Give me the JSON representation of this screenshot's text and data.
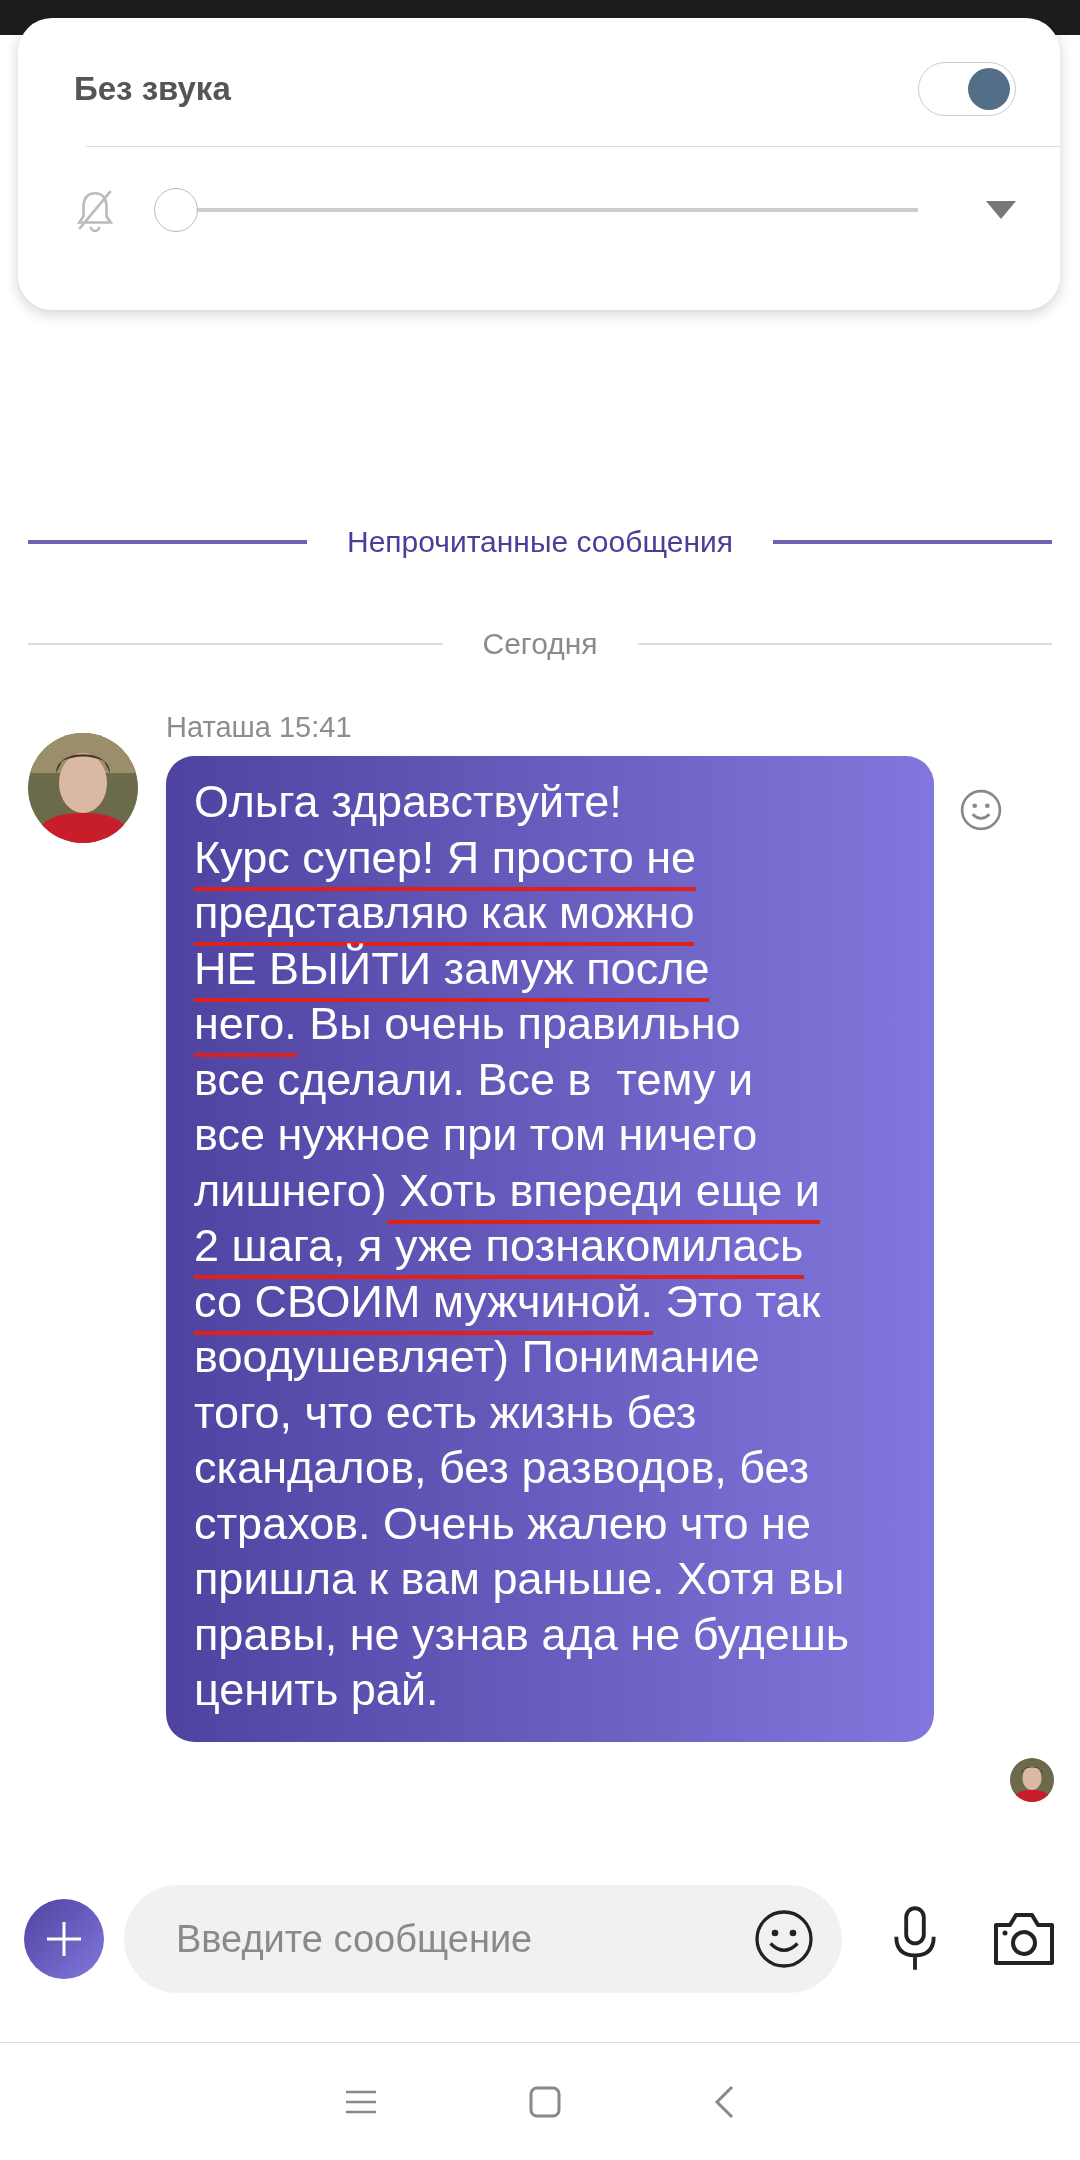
{
  "sound_panel": {
    "title": "Без звука",
    "toggle": {
      "on": true
    },
    "volume": {
      "level": 0
    }
  },
  "dividers": [
    {
      "kind": "unread",
      "label": "Непрочитанные сообщения"
    },
    {
      "kind": "date",
      "label": "Сегодня"
    }
  ],
  "message": {
    "sender": "Наташа 15:41",
    "lines": [
      [
        {
          "text": "Ольга здравствуйте!",
          "underlined": false
        }
      ],
      [
        {
          "text": "Курс супер! Я просто не",
          "underlined": true
        }
      ],
      [
        {
          "text": "представляю как можно",
          "underlined": true
        }
      ],
      [
        {
          "text": "НЕ ВЫЙТИ замуж после",
          "underlined": true
        }
      ],
      [
        {
          "text": "него.",
          "underlined": true
        },
        {
          "text": " Вы очень правильно",
          "underlined": false
        }
      ],
      [
        {
          "text": "все сделали. Все в  тему и",
          "underlined": false
        }
      ],
      [
        {
          "text": "все нужное при том ничего",
          "underlined": false
        }
      ],
      [
        {
          "text": "лишнего)",
          "underlined": false
        },
        {
          "text": " Хоть впереди еще и",
          "underlined": true
        }
      ],
      [
        {
          "text": "2 шага, я уже познакомилась",
          "underlined": true
        }
      ],
      [
        {
          "text": "со СВОИМ мужчиной.",
          "underlined": true
        },
        {
          "text": " Это так",
          "underlined": false
        }
      ],
      [
        {
          "text": "воодушевляет) Понимание",
          "underlined": false
        }
      ],
      [
        {
          "text": "того, что есть жизнь без",
          "underlined": false
        }
      ],
      [
        {
          "text": "скандалов, без разводов, без",
          "underlined": false
        }
      ],
      [
        {
          "text": "страхов. Очень жалею что не",
          "underlined": false
        }
      ],
      [
        {
          "text": "пришла к вам раньше. Хотя вы",
          "underlined": false
        }
      ],
      [
        {
          "text": "правы, не узнав ада не будешь",
          "underlined": false
        }
      ],
      [
        {
          "text": "ценить рай.",
          "underlined": false
        }
      ]
    ]
  },
  "composer": {
    "placeholder": "Введите сообщение"
  }
}
